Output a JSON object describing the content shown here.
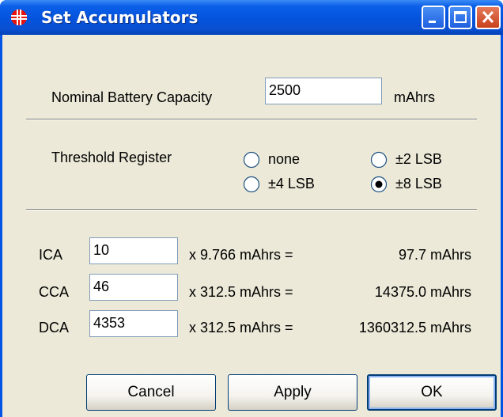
{
  "window": {
    "title": "Set Accumulators",
    "controls": {
      "minimize": "minimize",
      "maximize": "maximize",
      "close": "close"
    }
  },
  "capacity": {
    "label": "Nominal Battery Capacity",
    "value": "2500",
    "unit": "mAhrs"
  },
  "threshold": {
    "label": "Threshold Register",
    "options": [
      {
        "label": "none",
        "selected": false
      },
      {
        "label": "±2 LSB",
        "selected": false
      },
      {
        "label": "±4 LSB",
        "selected": false
      },
      {
        "label": "±8 LSB",
        "selected": true
      }
    ]
  },
  "accumulators": [
    {
      "name": "ICA",
      "value": "10",
      "multiplier": "x 9.766 mAhrs =",
      "result": "97.7 mAhrs"
    },
    {
      "name": "CCA",
      "value": "46",
      "multiplier": "x 312.5 mAhrs =",
      "result": "14375.0 mAhrs"
    },
    {
      "name": "DCA",
      "value": "4353",
      "multiplier": "x 312.5 mAhrs =",
      "result": "1360312.5 mAhrs"
    }
  ],
  "buttons": {
    "cancel": "Cancel",
    "apply": "Apply",
    "ok": "OK"
  },
  "colors": {
    "titlebar": "#0054e3",
    "dialog_bg": "#ece9d8",
    "close_button": "#c9401c"
  }
}
